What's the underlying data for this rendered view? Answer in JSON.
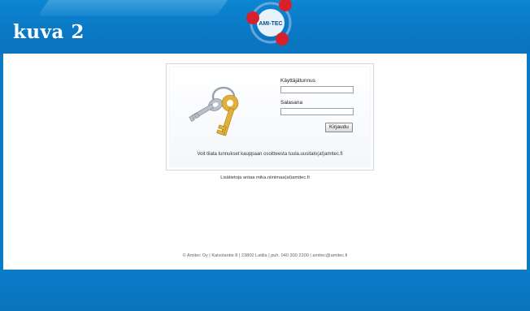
{
  "caption": "kuva 2",
  "logo": {
    "text": "AMI-TEC",
    "colors": {
      "ring": "#7aa8d8",
      "dots": "#d8202a",
      "core": "#ffffff"
    }
  },
  "login": {
    "username_label": "Käyttäjätunnus",
    "username_value": "",
    "password_label": "Salasana",
    "password_value": "",
    "submit_label": "Kirjaudu",
    "order_note": "Voit tilata tunnukset kauppaan osoitteesta tuula.uusitalo(at)amitec.fi",
    "icon": "keys-icon"
  },
  "more_info": "Lisätietoja antaa mika.niinimaa(at)amitec.fi",
  "footer": "© Amitec Oy | Kaivolantie 8 | 23800 Laitila | puh. 040 300 2200 | amitec@amitec.fi",
  "colors": {
    "brand_blue": "#0a79c6",
    "panel": "#ffffff",
    "text": "#222222"
  }
}
